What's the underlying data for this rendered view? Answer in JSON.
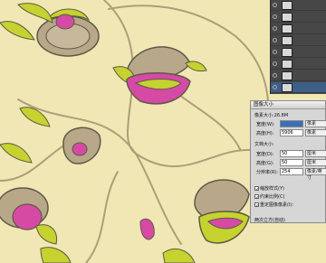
{
  "colors": {
    "background": "#f1e7b4",
    "leaf_green": "#c6d22f",
    "flower_pink": "#d64aa6",
    "petal_brown": "#b9a78a",
    "outline": "#5b5a45"
  },
  "layers_panel": {
    "rows": [
      {
        "name": "",
        "icon": "eye-icon",
        "selected": false
      },
      {
        "name": "",
        "icon": "eye-icon",
        "selected": false
      },
      {
        "name": "",
        "icon": "eye-icon",
        "selected": false
      },
      {
        "name": "",
        "icon": "eye-icon",
        "selected": false
      },
      {
        "name": "",
        "icon": "eye-icon",
        "selected": false
      },
      {
        "name": "",
        "icon": "eye-icon",
        "selected": false
      },
      {
        "name": "",
        "icon": "eye-icon",
        "selected": false
      },
      {
        "name": "",
        "icon": "eye-icon",
        "selected": true
      }
    ]
  },
  "dialog": {
    "title": "图像大小",
    "pixel_dimensions": "像素大小:26.8M",
    "width_label": "宽度(W):",
    "width_value": "",
    "width_unit": "像素",
    "height_label": "高度(H):",
    "height_value": "5906",
    "height_unit": "像素",
    "doc_size_label": "文档大小:",
    "doc_width_label": "宽度(D):",
    "doc_width_value": "50",
    "doc_width_unit": "厘米",
    "doc_height_label": "高度(G):",
    "doc_height_value": "50",
    "doc_height_unit": "厘米",
    "resolution_label": "分辨率(R):",
    "resolution_value": "254",
    "resolution_unit": "像素/英寸",
    "scale_styles": "缩放样式(Y)",
    "constrain": "约束比例(C)",
    "resample": "重定图像像素(I):",
    "method": "两次立方(自动)"
  }
}
